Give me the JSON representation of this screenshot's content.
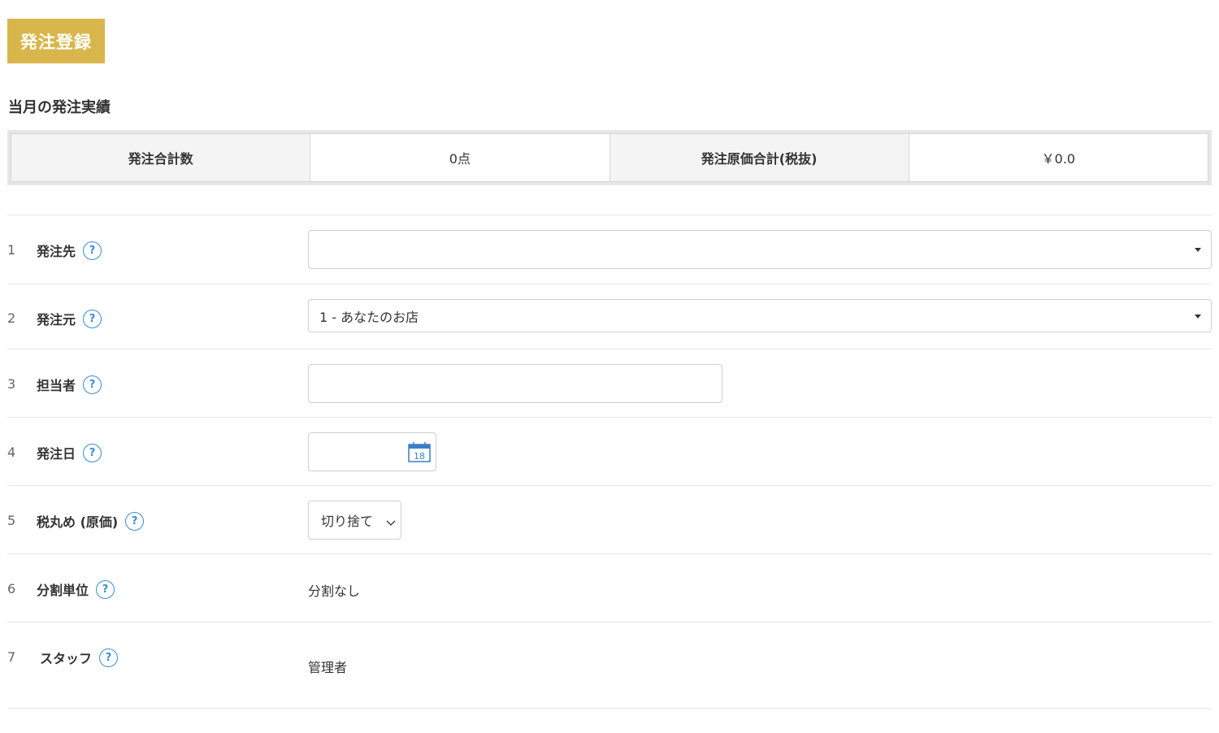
{
  "header": {
    "title": "発注登録"
  },
  "summary": {
    "section_title": "当月の発注実績",
    "total_count_label": "発注合計数",
    "total_count_value": "0点",
    "total_cost_label": "発注原価合計(税抜)",
    "total_cost_value": "￥0.0"
  },
  "form": {
    "rows": [
      {
        "num": "1",
        "label": "発注先",
        "value": ""
      },
      {
        "num": "2",
        "label": "発注元",
        "value": "1 - あなたのお店"
      },
      {
        "num": "3",
        "label": "担当者",
        "value": ""
      },
      {
        "num": "4",
        "label": "発注日",
        "value": "",
        "calendar_day": "18"
      },
      {
        "num": "5",
        "label": "税丸め (原価)",
        "value": "切り捨て"
      },
      {
        "num": "6",
        "label": "分割単位",
        "value": "分割なし"
      },
      {
        "num": "7",
        "label": "スタッフ",
        "value": "管理者"
      }
    ]
  },
  "help_glyph": "?",
  "colors": {
    "accent": "#d9b64c",
    "help_icon": "#3a8cd8"
  }
}
